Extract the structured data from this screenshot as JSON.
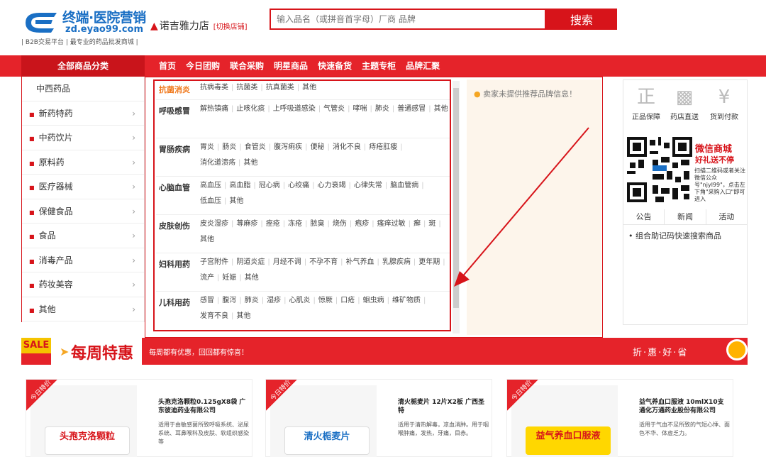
{
  "header": {
    "logo_title": "终端·医院营销",
    "logo_url": "zd.eyao99.com",
    "logo_slogan": "| B2B交易平台 | 最专业的药品批发商城 |",
    "shop_name": "诺吉雅力店",
    "switch_label": "[切换店铺]",
    "search_placeholder": "输入品名（或拼音首字母）厂商 品牌",
    "search_button": "搜索"
  },
  "nav": {
    "all_categories": "全部商品分类",
    "items": [
      "首页",
      "今日团购",
      "联合采购",
      "明星商品",
      "快速备货",
      "主题专柜",
      "品牌汇聚"
    ]
  },
  "sidebar": {
    "items": [
      "中西药品",
      "新药特药",
      "中药饮片",
      "原料药",
      "医疗器械",
      "保健食品",
      "食品",
      "消毒产品",
      "药妆美容",
      "其他"
    ]
  },
  "dropdown": {
    "categories": [
      {
        "name": "抗菌消炎",
        "links": [
          "抗病毒类",
          "抗菌类",
          "抗真菌类",
          "其他"
        ]
      },
      {
        "name": "呼吸感冒",
        "links": [
          "解热镇痛",
          "止咳化痰",
          "上呼吸道感染",
          "气管炎",
          "哮喘",
          "肺炎",
          "普通感冒",
          "其他"
        ]
      },
      {
        "name": "胃肠疾病",
        "links": [
          "胃炎",
          "肠炎",
          "食管炎",
          "腹泻痢疾",
          "便秘",
          "消化不良",
          "痔疮肛瘘",
          "消化道溃疡",
          "其他"
        ]
      },
      {
        "name": "心脑血管",
        "links": [
          "高血压",
          "高血脂",
          "冠心病",
          "心绞痛",
          "心力衰竭",
          "心律失常",
          "脑血管病",
          "低血压",
          "其他"
        ]
      },
      {
        "name": "皮肤创伤",
        "links": [
          "皮炎湿疹",
          "荨麻疹",
          "痤疮",
          "冻疮",
          "脓臭",
          "烧伤",
          "疱疹",
          "瘙痒过敏",
          "癣",
          "斑",
          "其他"
        ]
      },
      {
        "name": "妇科用药",
        "links": [
          "子宫附件",
          "阴道炎症",
          "月经不调",
          "不孕不育",
          "补气养血",
          "乳腺疾病",
          "更年期",
          "流产",
          "妊娠",
          "其他"
        ]
      },
      {
        "name": "儿科用药",
        "links": [
          "感冒",
          "腹泻",
          "肺炎",
          "湿疹",
          "心肌炎",
          "惊厥",
          "口疮",
          "蛔虫病",
          "维矿物质",
          "发育不良",
          "其他"
        ]
      }
    ],
    "brand_note": "卖家未提供推荐品牌信息！"
  },
  "right_panel": {
    "guarantees": [
      {
        "icon": "certified-icon",
        "label": "正品保障"
      },
      {
        "icon": "truck-icon",
        "label": "药店直送"
      },
      {
        "icon": "yen-icon",
        "label": "货到付款"
      }
    ],
    "wechat_title": "微信商城",
    "wechat_sub": "好礼送不停",
    "wechat_desc": "扫描二维码或者关注微信公众号\"njyl99\"，点击左下角\"采购入口\"即可进入",
    "tabs": [
      "公告",
      "新闻",
      "活动"
    ],
    "notice": "组合助记码快速搜索商品"
  },
  "weekly_sale": {
    "tag": "SALE",
    "title": "每周特惠",
    "subtitle": "每周都有优惠，回回都有惊喜！",
    "right_text": "折·惠·好·省"
  },
  "products": [
    {
      "ribbon": "今日特价",
      "box_text": "头孢克洛颗粒",
      "title": "头孢克洛颗粒0.125gX8袋 广东彼迪药业有限公司",
      "desc": "适用于由敏感菌所致呼吸系统、泌尿系统、耳鼻喉科及皮肤、软组织感染等"
    },
    {
      "ribbon": "今日特价",
      "box_text": "清火栀麦片",
      "title": "清火栀麦片 12片X2板 广西圣特",
      "desc": "适用于清热解毒，凉血消肿。用于咽喉肿痛，发热，牙痛，目赤。"
    },
    {
      "ribbon": "今日特价",
      "box_text": "益气养血口服液",
      "title": "益气养血口服液 10mlX10支 通化万通药业股份有限公司",
      "desc": "适用于气血不足所致的气短心悸、面色不华、体虚乏力。"
    }
  ],
  "colors": {
    "brand_red": "#e5232a",
    "accent_orange": "#f07a1e",
    "logo_blue": "#1a6fc4"
  }
}
